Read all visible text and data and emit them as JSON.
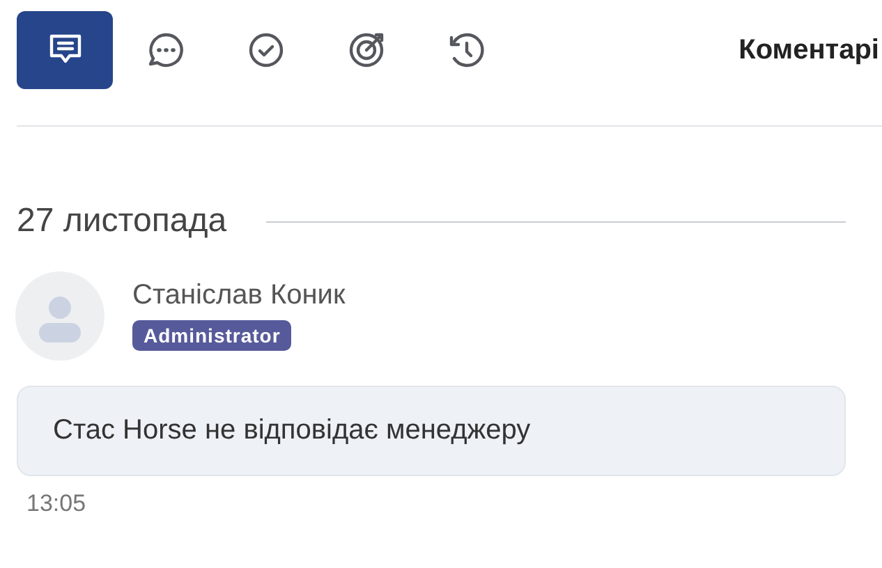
{
  "tabs": [
    {
      "kind": "comments",
      "selected": true
    },
    {
      "kind": "chat",
      "selected": false
    },
    {
      "kind": "check",
      "selected": false
    },
    {
      "kind": "target",
      "selected": false
    },
    {
      "kind": "history",
      "selected": false
    }
  ],
  "title": "Коментарі",
  "date": "27 листопада",
  "comment": {
    "author": "Станіслав Коник",
    "role": "Administrator",
    "text": "Стас Horse не відповідає менеджеру",
    "time": "13:05"
  }
}
